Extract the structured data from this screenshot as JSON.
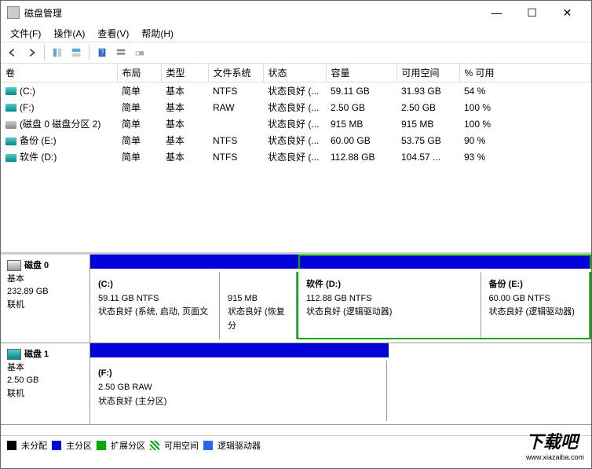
{
  "window": {
    "title": "磁盘管理",
    "min": "—",
    "max": "☐",
    "close": "✕"
  },
  "menu": {
    "file": "文件(F)",
    "operate": "操作(A)",
    "view": "查看(V)",
    "help": "帮助(H)"
  },
  "columns": {
    "volume": "卷",
    "layout": "布局",
    "type": "类型",
    "fs": "文件系统",
    "status": "状态",
    "capacity": "容量",
    "free": "可用空间",
    "pct": "% 可用"
  },
  "volumes": [
    {
      "icon": "teal",
      "name": "(C:)",
      "layout": "简单",
      "type": "基本",
      "fs": "NTFS",
      "status": "状态良好 (...",
      "cap": "59.11 GB",
      "free": "31.93 GB",
      "pct": "54 %"
    },
    {
      "icon": "teal",
      "name": "(F:)",
      "layout": "简单",
      "type": "基本",
      "fs": "RAW",
      "status": "状态良好 (...",
      "cap": "2.50 GB",
      "free": "2.50 GB",
      "pct": "100 %"
    },
    {
      "icon": "gray",
      "name": "(磁盘 0 磁盘分区 2)",
      "layout": "简单",
      "type": "基本",
      "fs": "",
      "status": "状态良好 (...",
      "cap": "915 MB",
      "free": "915 MB",
      "pct": "100 %"
    },
    {
      "icon": "teal",
      "name": "备份 (E:)",
      "layout": "简单",
      "type": "基本",
      "fs": "NTFS",
      "status": "状态良好 (...",
      "cap": "60.00 GB",
      "free": "53.75 GB",
      "pct": "90 %"
    },
    {
      "icon": "teal",
      "name": "软件 (D:)",
      "layout": "简单",
      "type": "基本",
      "fs": "NTFS",
      "status": "状态良好 (...",
      "cap": "112.88 GB",
      "free": "104.57 ...",
      "pct": "93 %"
    }
  ],
  "disk0": {
    "name": "磁盘 0",
    "type": "基本",
    "size": "232.89 GB",
    "status": "联机",
    "p1": {
      "title": "(C:)",
      "size": "59.11 GB NTFS",
      "status": "状态良好 (系统, 启动, 页面文"
    },
    "p2": {
      "title": "",
      "size": "915 MB",
      "status": "状态良好 (恢复分"
    },
    "p3": {
      "title": "软件   (D:)",
      "size": "112.88 GB NTFS",
      "status": "状态良好 (逻辑驱动器)"
    },
    "p4": {
      "title": "备份   (E:)",
      "size": "60.00 GB NTFS",
      "status": "状态良好 (逻辑驱动器)"
    }
  },
  "disk1": {
    "name": "磁盘 1",
    "type": "基本",
    "size": "2.50 GB",
    "status": "联机",
    "p1": {
      "title": "(F:)",
      "size": "2.50 GB RAW",
      "status": "状态良好 (主分区)"
    }
  },
  "legend": {
    "unalloc": "未分配",
    "primary": "主分区",
    "extended": "扩展分区",
    "free": "可用空间",
    "logical": "逻辑驱动器"
  },
  "watermark": {
    "main": "下载吧",
    "sub": "www.xiazaiba.com"
  }
}
